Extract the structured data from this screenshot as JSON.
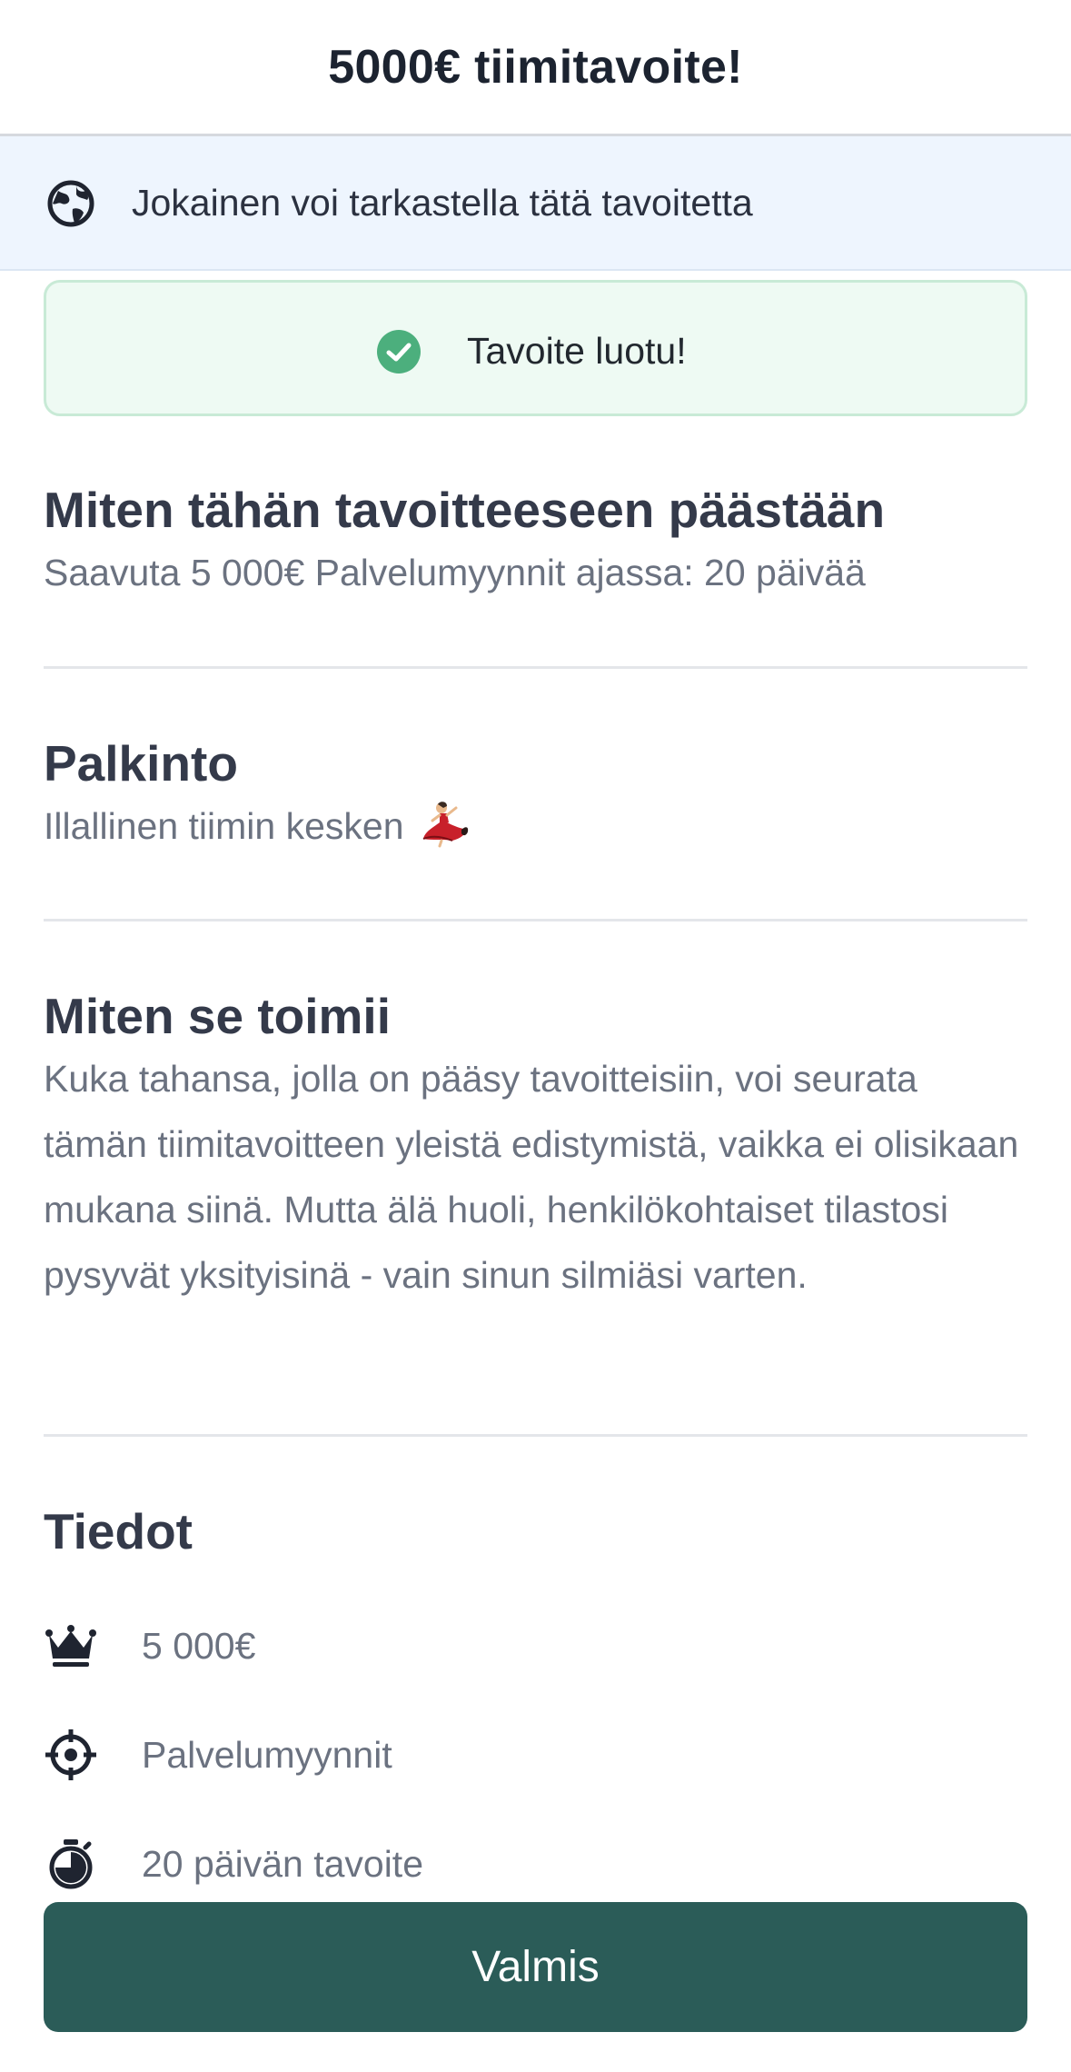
{
  "header": {
    "title": "5000€ tiimitavoite!"
  },
  "visibility_banner": {
    "icon": "globe-icon",
    "text": "Jokainen voi tarkastella tätä tavoitetta"
  },
  "success_message": {
    "icon": "check-circle-icon",
    "text": "Tavoite luotu!",
    "color": "#4caf7d"
  },
  "how_to_reach": {
    "heading": "Miten tähän tavoitteeseen päästään",
    "text": "Saavuta 5 000€ Palvelumyynnit ajassa: 20 päivää"
  },
  "reward": {
    "heading": "Palkinto",
    "text": "Illallinen tiimin kesken",
    "emoji": "dancer-emoji"
  },
  "how_it_works": {
    "heading": "Miten se toimii",
    "text": "Kuka tahansa, jolla on pääsy tavoitteisiin, voi seurata tämän tiimitavoitteen yleistä edistymistä, vaikka ei olisikaan mukana siinä. Mutta älä huoli, henkilökohtaiset tilastosi pysyvät yksityisinä - vain sinun silmiäsi varten."
  },
  "details": {
    "heading": "Tiedot",
    "items": [
      {
        "icon": "crown-icon",
        "label": "5 000€"
      },
      {
        "icon": "target-icon",
        "label": "Palvelumyynnit"
      },
      {
        "icon": "stopwatch-icon",
        "label": "20 päivän tavoite"
      }
    ]
  },
  "footer": {
    "done_label": "Valmis",
    "button_color": "#2b5c58"
  }
}
